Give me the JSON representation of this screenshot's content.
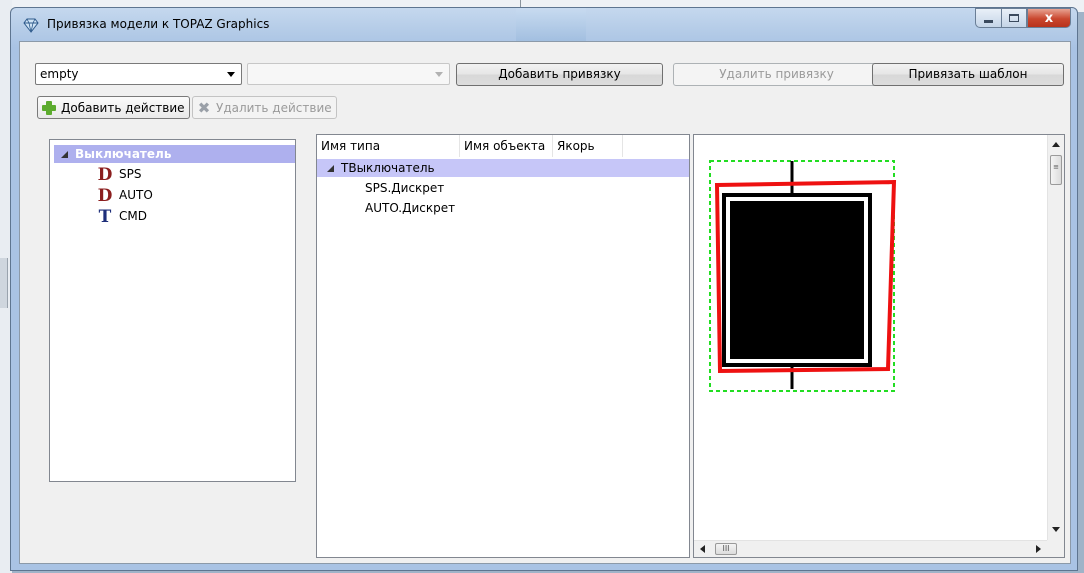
{
  "window": {
    "title": "Привязка модели к TOPAZ Graphics",
    "minimize_icon": "minimize-icon",
    "maximize_icon": "maximize-icon",
    "close_icon": "close-icon",
    "close_glyph": "x"
  },
  "toolbar": {
    "model_combo_value": "empty",
    "object_combo_value": "",
    "add_binding_label": "Добавить привязку",
    "remove_binding_label": "Удалить привязку",
    "bind_template_label": "Привязать шаблон",
    "add_action_label": "Добавить действие",
    "remove_action_label": "Удалить действие"
  },
  "left_tree": {
    "root": "Выключатель",
    "items": [
      {
        "icon": "D",
        "label": "SPS"
      },
      {
        "icon": "D",
        "label": "AUTO"
      },
      {
        "icon": "T",
        "label": "CMD"
      }
    ]
  },
  "middle_table": {
    "columns": [
      "Имя типа",
      "Имя объекта",
      "Якорь"
    ],
    "root": "ТВыключатель",
    "rows": [
      "SPS.Дискрет",
      "AUTO.Дискрет"
    ]
  },
  "preview": {
    "scroll_grip": "III",
    "colors": {
      "selection_outline": "#22dd22",
      "highlight": "#ee1111",
      "symbol_fill": "#000000"
    }
  },
  "colors": {
    "tree_selection": "#c6c6f8",
    "tree_selection_dark": "#aeb0ee"
  }
}
